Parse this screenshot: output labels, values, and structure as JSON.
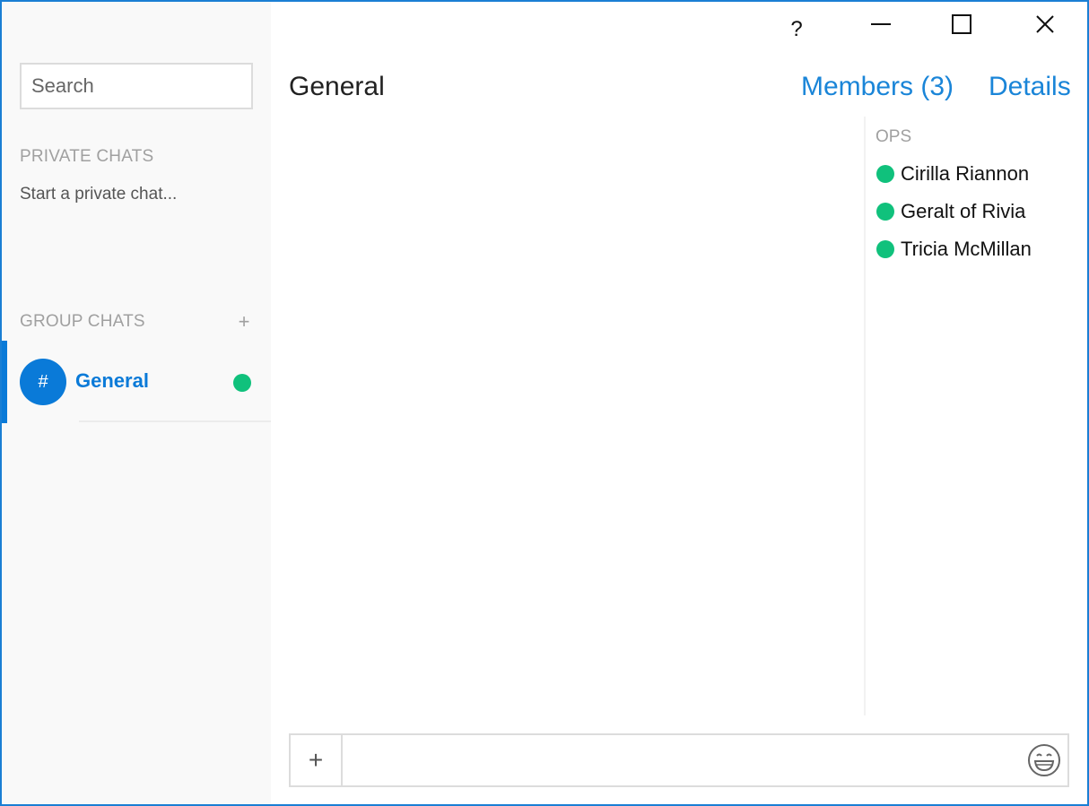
{
  "sidebar": {
    "search": {
      "placeholder": "Search",
      "value": ""
    },
    "private_header": "PRIVATE CHATS",
    "private_start": "Start a private chat...",
    "group_header": "GROUP CHATS",
    "add_group_icon": "+",
    "group_chats": [
      {
        "avatar_icon": "#",
        "name": "General",
        "status": "online",
        "active": true
      }
    ]
  },
  "titlebar": {
    "help_label": "?"
  },
  "header": {
    "channel_title": "General",
    "members_link": "Members (3)",
    "details_link": "Details"
  },
  "members": {
    "group_label": "OPS",
    "list": [
      {
        "name": "Cirilla Riannon",
        "status": "online"
      },
      {
        "name": "Geralt of Rivia",
        "status": "online"
      },
      {
        "name": "Tricia McMillan",
        "status": "online"
      }
    ]
  },
  "composer": {
    "add_icon": "+",
    "value": "",
    "emoji_icon": "grinning-face-icon"
  },
  "colors": {
    "accent": "#0a7ad8",
    "link": "#1a85d8",
    "online": "#10c17c",
    "window_border": "#1a7fd4"
  }
}
